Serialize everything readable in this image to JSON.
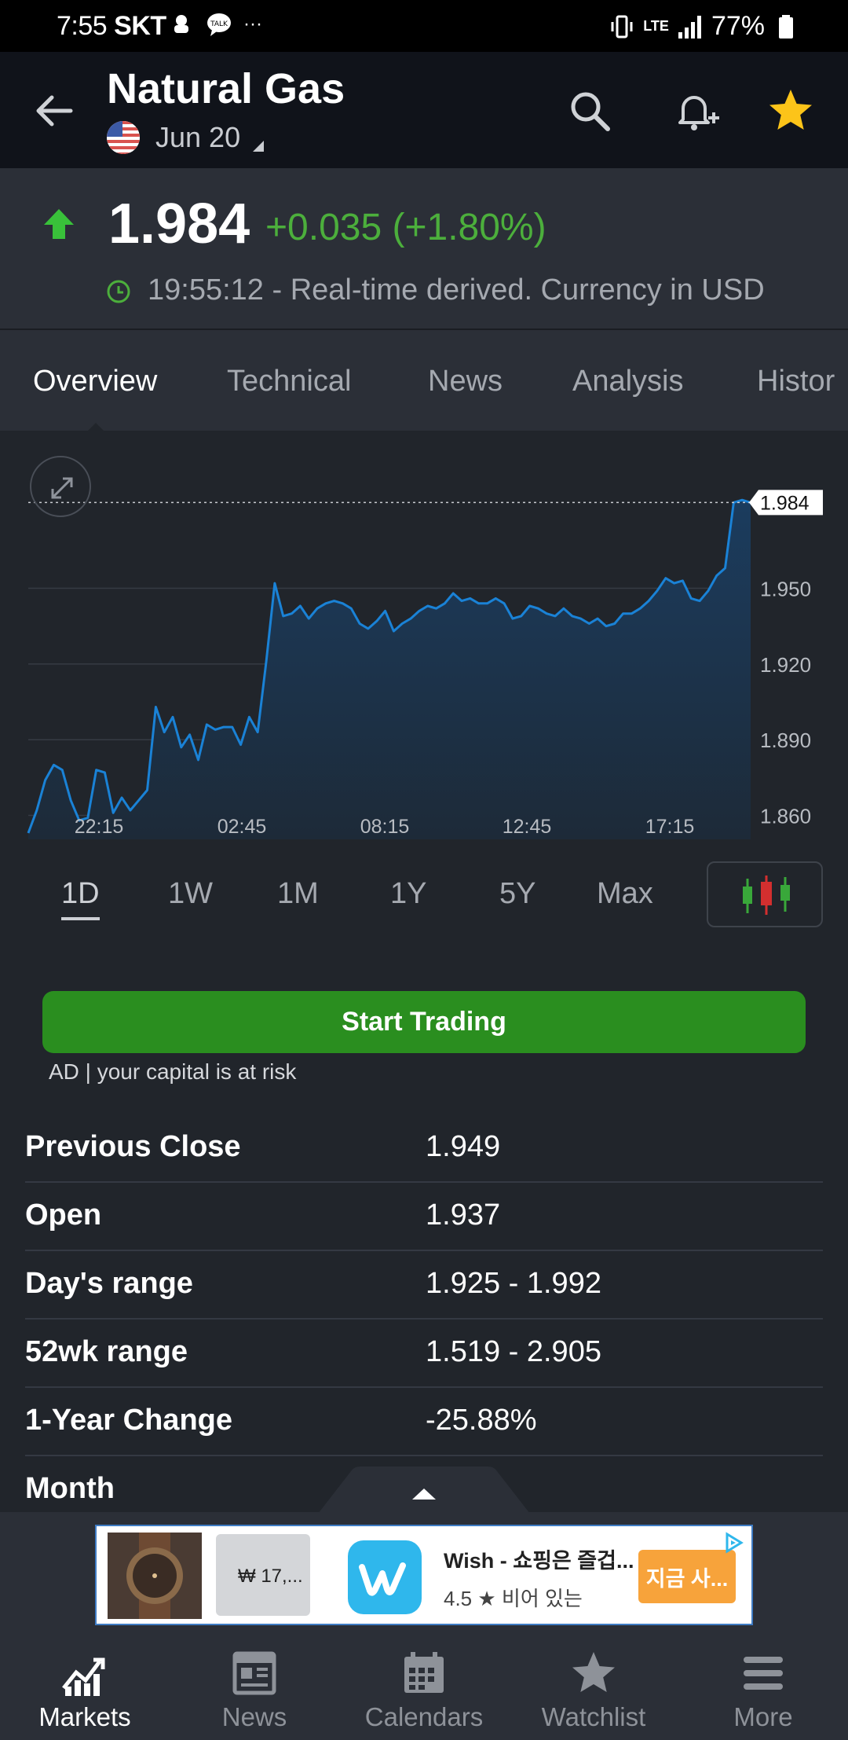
{
  "status_bar": {
    "time": "7:55",
    "carrier": "SKT",
    "dots": "···",
    "network": "LTE",
    "battery": "77%"
  },
  "header": {
    "title": "Natural Gas",
    "contract": "Jun 20",
    "icons": [
      "back-arrow-icon",
      "search-icon",
      "add-alert-icon",
      "star-icon"
    ],
    "star_color": "#fcc419"
  },
  "quote": {
    "price": "1.984",
    "change": "+0.035 (+1.80%)",
    "timestamp_text": "19:55:12 - Real-time derived. Currency in USD",
    "up_color": "#4caf3c"
  },
  "tabs": [
    {
      "label": "Overview",
      "active": true
    },
    {
      "label": "Technical",
      "active": false
    },
    {
      "label": "News",
      "active": false
    },
    {
      "label": "Analysis",
      "active": false
    },
    {
      "label": "Histor",
      "active": false
    }
  ],
  "chart_data": {
    "type": "area",
    "x_tick_labels": [
      "22:15",
      "02:45",
      "08:15",
      "12:45",
      "17:15"
    ],
    "y_tick_labels": [
      "1.950",
      "1.920",
      "1.890",
      "1.860"
    ],
    "ylim": [
      1.853,
      2.0
    ],
    "last_price_label": "1.984",
    "line_color": "#1a82d6",
    "series": [
      {
        "values": [
          1.853,
          1.862,
          1.874,
          1.88,
          1.878,
          1.866,
          1.858,
          1.859,
          1.878,
          1.877,
          1.861,
          1.867,
          1.862,
          1.866,
          1.87,
          1.903,
          1.893,
          1.899,
          1.887,
          1.892,
          1.882,
          1.896,
          1.894,
          1.895,
          1.895,
          1.888,
          1.899,
          1.893,
          1.921,
          1.952,
          1.939,
          1.94,
          1.943,
          1.938,
          1.942,
          1.944,
          1.945,
          1.944,
          1.942,
          1.936,
          1.934,
          1.937,
          1.941,
          1.933,
          1.936,
          1.938,
          1.941,
          1.943,
          1.942,
          1.944,
          1.948,
          1.945,
          1.946,
          1.944,
          1.944,
          1.946,
          1.944,
          1.938,
          1.939,
          1.943,
          1.942,
          1.94,
          1.939,
          1.942,
          1.939,
          1.938,
          1.936,
          1.938,
          1.935,
          1.936,
          1.94,
          1.94,
          1.942,
          1.945,
          1.949,
          1.954,
          1.952,
          1.953,
          1.946,
          1.945,
          1.949,
          1.955,
          1.958,
          1.984,
          1.985,
          1.984
        ]
      }
    ]
  },
  "ranges": [
    {
      "label": "1D",
      "active": true
    },
    {
      "label": "1W",
      "active": false
    },
    {
      "label": "1M",
      "active": false
    },
    {
      "label": "1Y",
      "active": false
    },
    {
      "label": "5Y",
      "active": false
    },
    {
      "label": "Max",
      "active": false
    }
  ],
  "trade": {
    "button_label": "Start Trading",
    "button_color": "#2a8e1f",
    "disclaimer": "AD | your capital is at risk"
  },
  "stats": [
    {
      "label": "Previous Close",
      "value": "1.949"
    },
    {
      "label": "Open",
      "value": "1.937"
    },
    {
      "label": "Day's range",
      "value": "1.925 - 1.992"
    },
    {
      "label": "52wk range",
      "value": "1.519 - 2.905"
    },
    {
      "label": "1-Year Change",
      "value": "-25.88%"
    },
    {
      "label": "Month",
      "value": ""
    }
  ],
  "ad": {
    "product_price": "₩ 17,...",
    "title": "Wish - 쇼핑은 즐겁...",
    "rating": "4.5 ★  비어 있는",
    "cta": "지금 사..."
  },
  "bottom_nav": [
    {
      "label": "Markets",
      "icon": "markets-chart-icon",
      "active": true
    },
    {
      "label": "News",
      "icon": "news-icon",
      "active": false
    },
    {
      "label": "Calendars",
      "icon": "calendar-icon",
      "active": false
    },
    {
      "label": "Watchlist",
      "icon": "star-icon",
      "active": false
    },
    {
      "label": "More",
      "icon": "menu-icon",
      "active": false
    }
  ]
}
